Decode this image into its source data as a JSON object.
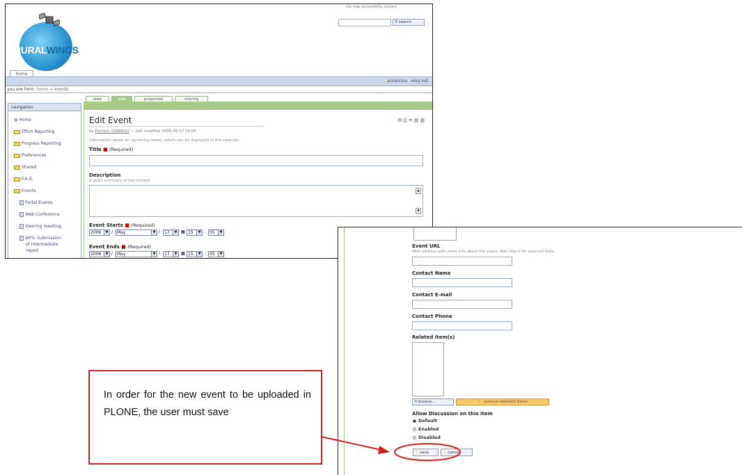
{
  "top_links": "site map   accessibility   contact",
  "search": {
    "button": "search"
  },
  "logo": {
    "text_part1": "RURAL",
    "text_part2": "WINGS"
  },
  "home_tab": "home",
  "user": {
    "name": "ioannou",
    "logout": "log out"
  },
  "breadcrumb": {
    "prefix": "you are here:",
    "home": "home",
    "arrow": "→",
    "current": "events"
  },
  "navigation": {
    "title": "navigation",
    "items": [
      {
        "label": "Home",
        "icon": "home-icon"
      },
      {
        "label": "Effort Reporting",
        "icon": "folder-icon"
      },
      {
        "label": "Progress Reporting",
        "icon": "folder-icon"
      },
      {
        "label": "Preferences",
        "icon": "folder-icon"
      },
      {
        "label": "Shared",
        "icon": "folder-icon"
      },
      {
        "label": "F.A.Q.",
        "icon": "folder-icon"
      },
      {
        "label": "Events",
        "icon": "folder-icon"
      },
      {
        "label": "Portal Events",
        "icon": "topic-icon"
      },
      {
        "label": "Web Conference",
        "icon": "event-icon"
      },
      {
        "label": "steering meeting.",
        "icon": "event-icon"
      },
      {
        "label": "WP3- Submission",
        "icon": "event-icon"
      },
      {
        "label": "of intermediate",
        "icon": ""
      },
      {
        "label": "report",
        "icon": ""
      }
    ]
  },
  "content_tabs": [
    "view",
    "edit",
    "properties",
    "sharing"
  ],
  "edit": {
    "title": "Edit Event",
    "byline_prefix": "by",
    "author": "Pantelis IOANNOU",
    "byline_suffix": "— last modified 2006-05-17 15:05",
    "intro": "Information about an upcoming event, which can be displayed in the calendar.",
    "title_label": "Title",
    "required": "(Required)",
    "description_label": "Description",
    "description_help": "A short summary of the content",
    "event_starts_label": "Event Starts",
    "event_ends_label": "Event Ends",
    "start": {
      "year": "2006",
      "month": "May",
      "day": "17",
      "hour": "15",
      "minute": "05"
    },
    "end": {
      "year": "2006",
      "month": "May",
      "day": "17",
      "hour": "15",
      "minute": "05"
    }
  },
  "form2": {
    "event_url_label": "Event URL",
    "event_url_help": "Web address with more info about the event. Add http:// for external links.",
    "contact_name_label": "Contact Name",
    "contact_email_label": "Contact E-mail",
    "contact_phone_label": "Contact Phone",
    "related_items_label": "Related Item(s)",
    "browse_button": "browse...",
    "remove_button": "remove selected items",
    "discussion_label": "Allow Discussion on this item",
    "discussion_options": [
      "Default",
      "Enabled",
      "Disabled"
    ],
    "discussion_selected": "Default",
    "save_button": "save",
    "cancel_button": "cancel"
  },
  "callout": {
    "text": "In order for the new event to be uploaded in PLONE, the user must save"
  },
  "colors": {
    "callout_border": "#d21f1f",
    "accent_green": "#a8c98a",
    "logo_blue": "#1e88c8"
  }
}
